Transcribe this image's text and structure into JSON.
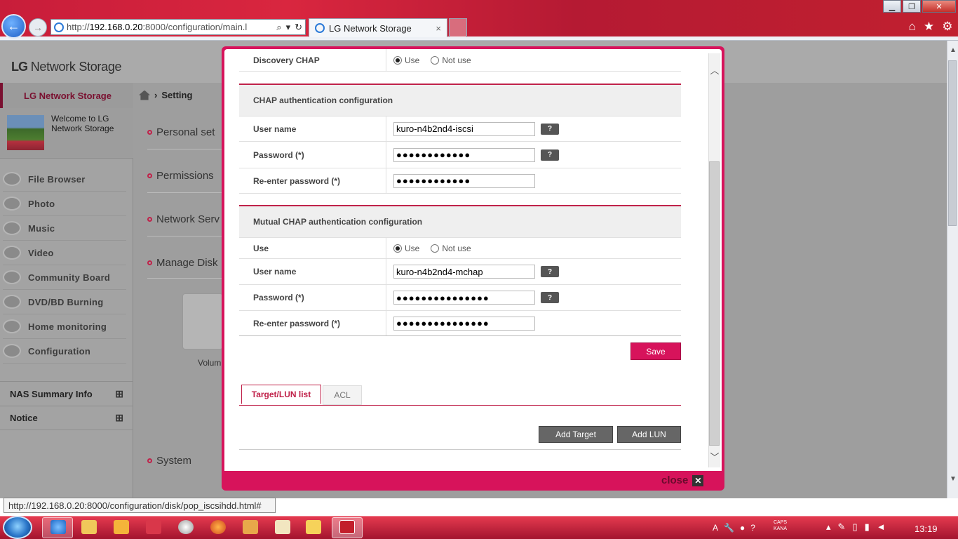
{
  "browser": {
    "address": "http://",
    "address_host": "192.168.0.20",
    "address_rest": ":8000/configuration/main.l",
    "tab_title": "LG Network Storage",
    "status_url": "http://192.168.0.20:8000/configuration/disk/pop_iscsihdd.html#"
  },
  "app": {
    "logo_lg": "LG",
    "logo_text": "Network Storage",
    "side_header": "LG Network Storage",
    "welcome": "Welcome to LG Network Storage",
    "breadcrumb": "Setting",
    "menu": [
      {
        "label": "File Browser",
        "icon": "file-browser-icon"
      },
      {
        "label": "Photo",
        "icon": "photo-icon"
      },
      {
        "label": "Music",
        "icon": "music-icon"
      },
      {
        "label": "Video",
        "icon": "video-icon"
      },
      {
        "label": "Community Board",
        "icon": "community-board-icon"
      },
      {
        "label": "DVD/BD Burning",
        "icon": "disc-icon"
      },
      {
        "label": "Home monitoring",
        "icon": "webcam-icon"
      },
      {
        "label": "Configuration",
        "icon": "gear-icon"
      }
    ],
    "nas_summary": "NAS Summary Info",
    "notice": "Notice",
    "sections": [
      "Personal set",
      "Permissions",
      "Network Serv",
      "Manage Disk",
      "System"
    ],
    "volume_label": "Volum"
  },
  "modal": {
    "discovery_chap_label": "Discovery CHAP",
    "use_label": "Use",
    "not_use_label": "Not use",
    "chap_header": "CHAP authentication configuration",
    "chap_user_label": "User name",
    "chap_user_value": "kuro-n4b2nd4-iscsi",
    "chap_pass_label": "Password (*)",
    "chap_pass_value": "●●●●●●●●●●●●",
    "chap_repass_label": "Re-enter password (*)",
    "chap_repass_value": "●●●●●●●●●●●●",
    "mchap_header": "Mutual CHAP authentication configuration",
    "mchap_use_label": "Use",
    "mchap_user_label": "User name",
    "mchap_user_value": "kuro-n4b2nd4-mchap",
    "mchap_pass_label": "Password (*)",
    "mchap_pass_value": "●●●●●●●●●●●●●●●",
    "mchap_repass_label": "Re-enter password (*)",
    "mchap_repass_value": "●●●●●●●●●●●●●●●",
    "help_label": "?",
    "save_label": "Save",
    "tab_target": "Target/LUN list",
    "tab_acl": "ACL",
    "add_target_label": "Add Target",
    "add_lun_label": "Add LUN",
    "close_label": "close",
    "close_x": "✕"
  },
  "taskbar": {
    "clock": "13:19",
    "caps": "CAPS",
    "kana": "KANA"
  },
  "colors": {
    "accent": "#d7135b",
    "taskbar": "#c41f36"
  }
}
